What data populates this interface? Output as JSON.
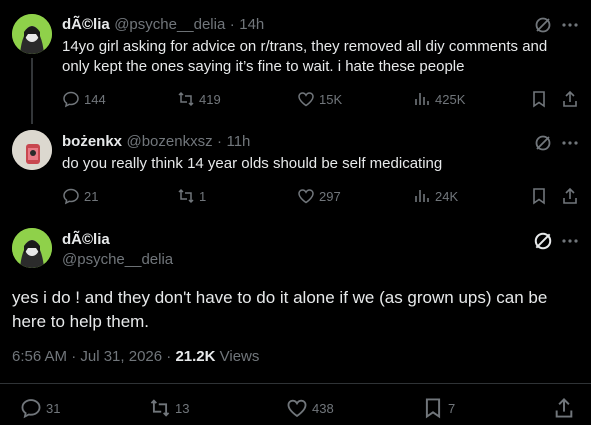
{
  "tweet1": {
    "name": "dÃ©lia",
    "handle": "@psyche__delia",
    "time": "14h",
    "text": "14yo girl asking for advice on r/trans, they removed all diy comments and only kept the ones saying it’s fine to wait. i hate these people",
    "replies": "144",
    "reposts": "419",
    "likes": "15K",
    "views": "425K"
  },
  "tweet2": {
    "name": "bożenkx",
    "handle": "@bozenkxsz",
    "time": "11h",
    "text": "do you really think 14 year olds should be self medicating",
    "replies": "21",
    "reposts": "1",
    "likes": "297",
    "views": "24K"
  },
  "main_tweet": {
    "name": "dÃ©lia",
    "handle": "@psyche__delia",
    "text": "yes i do ! and they don't have to do it alone if we (as grown ups) can be here to help them.",
    "timestamp": "6:56 AM · Jul 31, 2026 ·",
    "views_count": "21.2K",
    "views_label": "Views",
    "replies": "31",
    "reposts": "13",
    "likes": "438",
    "bookmarks": "7"
  },
  "separators": {
    "dot": "·"
  },
  "colors": {
    "background": "#000000",
    "text": "#e7e9ea",
    "muted": "#71767b",
    "divider": "#2f3336"
  }
}
